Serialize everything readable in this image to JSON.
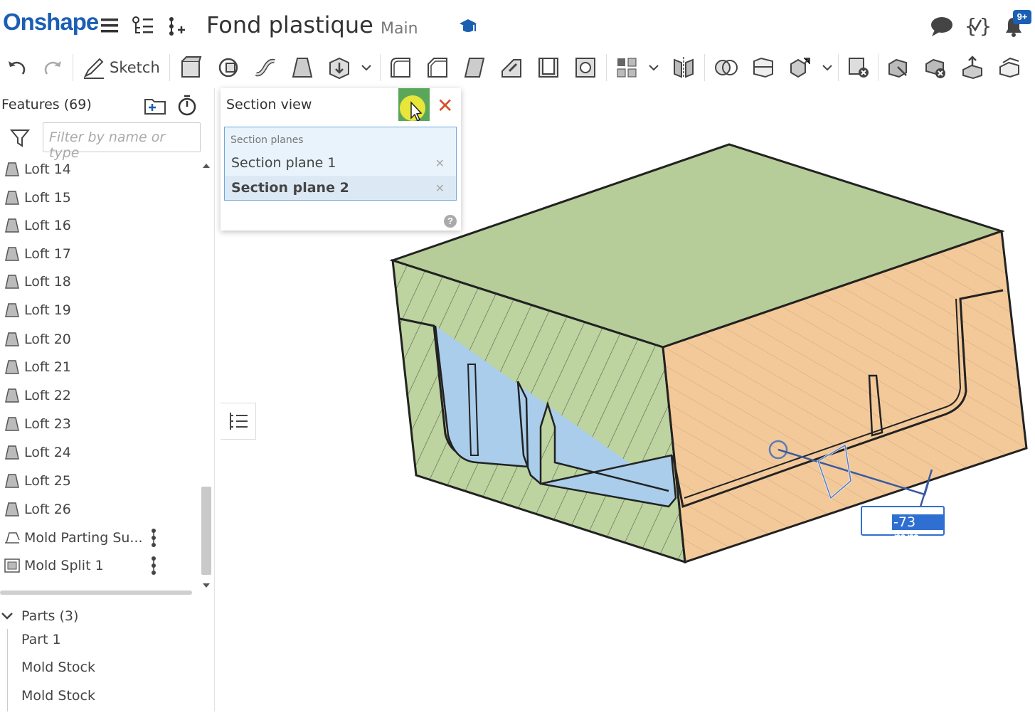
{
  "app": {
    "logo": "Onshape",
    "title": "Fond plastique",
    "branch": "Main",
    "notif_badge": "9+"
  },
  "toolbar": {
    "sketch_label": "Sketch"
  },
  "features": {
    "header": "Features (69)",
    "filter_placeholder": "Filter by name or type",
    "items": [
      {
        "label": "Loft 14"
      },
      {
        "label": "Loft 15"
      },
      {
        "label": "Loft 16"
      },
      {
        "label": "Loft 17"
      },
      {
        "label": "Loft 18"
      },
      {
        "label": "Loft 19"
      },
      {
        "label": "Loft 20"
      },
      {
        "label": "Loft 21"
      },
      {
        "label": "Loft 22"
      },
      {
        "label": "Loft 23"
      },
      {
        "label": "Loft 24"
      },
      {
        "label": "Loft 25"
      },
      {
        "label": "Loft 26"
      },
      {
        "label": "Mold Parting Su..."
      },
      {
        "label": "Mold Split 1"
      }
    ]
  },
  "parts": {
    "header": "Parts (3)",
    "items": [
      {
        "label": "Part 1"
      },
      {
        "label": "Mold Stock"
      },
      {
        "label": "Mold Stock"
      }
    ]
  },
  "section_view": {
    "title": "Section view",
    "box_label": "Section planes",
    "planes": [
      {
        "label": "Section plane 1"
      },
      {
        "label": "Section plane 2"
      }
    ],
    "help": "?"
  },
  "dimension": {
    "value": "-73 mm"
  },
  "colors": {
    "accent": "#1b5fb3",
    "ok": "#5aa65a",
    "cancel": "#d8502a",
    "green_face": "#b9cf9d",
    "orange_face": "#f3c99a",
    "cavity": "#a9cdea"
  }
}
